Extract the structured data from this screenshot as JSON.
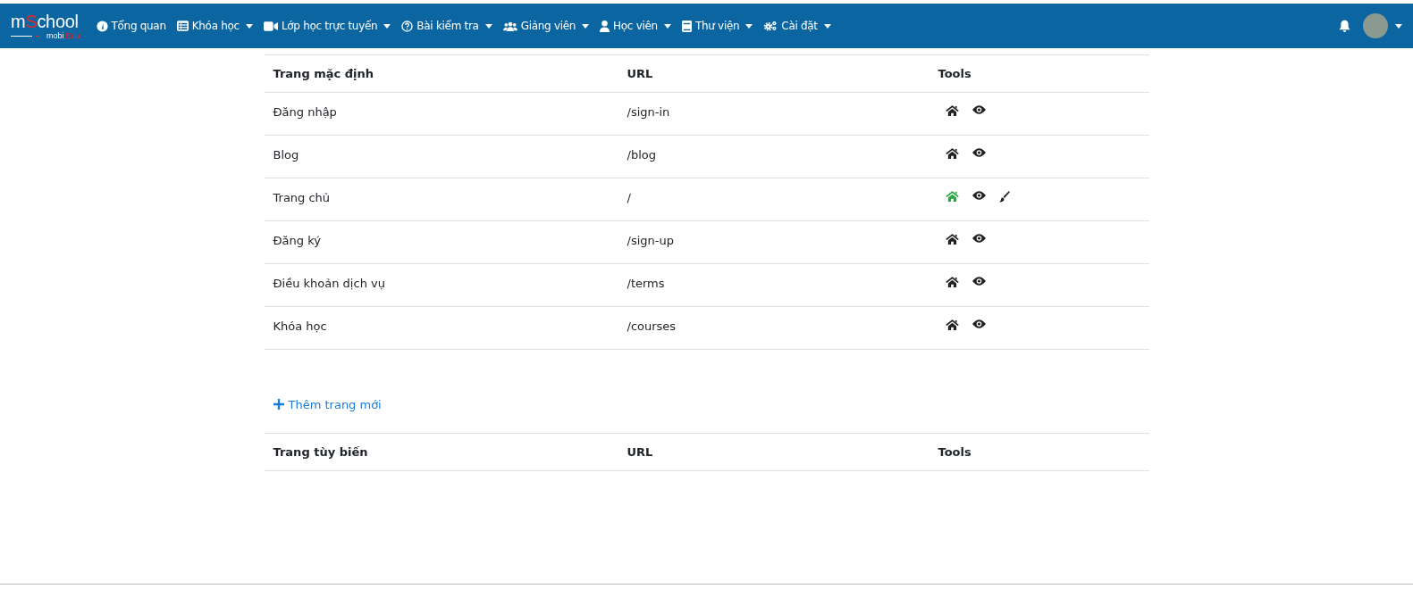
{
  "navbar": {
    "logo": {
      "parts": [
        {
          "text": "m",
          "accent": false
        },
        {
          "text": "S",
          "accent": true
        },
        {
          "text": "chool",
          "accent": false
        }
      ],
      "sub_parts": [
        {
          "text": "mobi",
          "accent": false
        },
        {
          "text": "Edu",
          "accent": true
        }
      ]
    },
    "items": [
      {
        "label": "Tổng quan",
        "dropdown": false
      },
      {
        "label": "Khóa học",
        "dropdown": true
      },
      {
        "label": "Lớp học trực tuyến",
        "dropdown": true
      },
      {
        "label": "Bài kiểm tra",
        "dropdown": true
      },
      {
        "label": "Giảng viên",
        "dropdown": true
      },
      {
        "label": "Học viên",
        "dropdown": true
      },
      {
        "label": "Thư viện",
        "dropdown": true
      },
      {
        "label": "Cài đặt",
        "dropdown": true
      }
    ]
  },
  "default_pages": {
    "columns": [
      "Trang mặc định",
      "URL",
      "Tools"
    ],
    "rows": [
      {
        "name": "Đăng nhập",
        "url": "/sign-in",
        "is_home": false,
        "editable": false
      },
      {
        "name": "Blog",
        "url": "/blog",
        "is_home": false,
        "editable": false
      },
      {
        "name": "Trang chủ",
        "url": "/",
        "is_home": true,
        "editable": true
      },
      {
        "name": "Đăng ký",
        "url": "/sign-up",
        "is_home": false,
        "editable": false
      },
      {
        "name": "Điều khoản dịch vụ",
        "url": "/terms",
        "is_home": false,
        "editable": false
      },
      {
        "name": "Khóa học",
        "url": "/courses",
        "is_home": false,
        "editable": false
      }
    ]
  },
  "add_page_link": "Thêm trang mới",
  "custom_pages": {
    "columns": [
      "Trang tùy biến",
      "URL",
      "Tools"
    ]
  }
}
